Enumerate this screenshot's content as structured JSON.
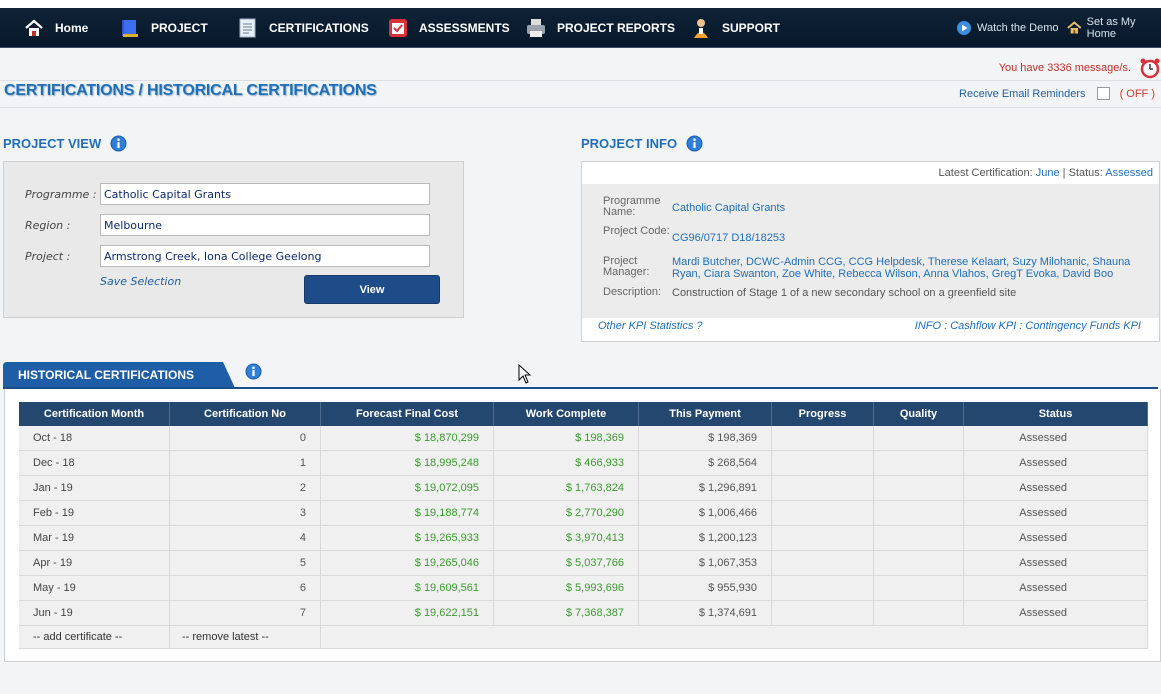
{
  "nav": {
    "items": [
      {
        "label": "Home",
        "icon": "home-icon"
      },
      {
        "label": "PROJECT",
        "icon": "project-book-icon"
      },
      {
        "label": "CERTIFICATIONS",
        "icon": "certificate-document-icon"
      },
      {
        "label": "ASSESSMENTS",
        "icon": "assessment-clipboard-icon"
      },
      {
        "label": "PROJECT REPORTS",
        "icon": "printer-icon"
      },
      {
        "label": "SUPPORT",
        "icon": "support-person-icon"
      }
    ],
    "watch_demo": "Watch the Demo",
    "set_home": "Set as My Home"
  },
  "messages": {
    "text": "You have 3336 message/s."
  },
  "page": {
    "title": "CERTIFICATIONS / HISTORICAL CERTIFICATIONS",
    "reminder_label": "Receive Email Reminders",
    "reminder_state": "( OFF )"
  },
  "project_view": {
    "title": "PROJECT VIEW",
    "programme_label": "Programme :",
    "programme_value": "Catholic Capital Grants",
    "region_label": "Region :",
    "region_value": "Melbourne",
    "project_label": "Project :",
    "project_value": "Armstrong Creek, Iona College Geelong",
    "save_selection": "Save Selection",
    "view_button": "View"
  },
  "project_info": {
    "title": "PROJECT INFO",
    "latest_label": "Latest Certification:",
    "latest_value": "June",
    "status_label": "Status:",
    "status_value": "Assessed",
    "programme_name_label": "Programme Name:",
    "programme_name": "Catholic Capital Grants",
    "project_code_label": "Project Code:",
    "project_code": "CG96/0717 D18/18253",
    "manager_label": "Project Manager:",
    "managers": "Mardi Butcher, DCWC-Admin CCG, CCG Helpdesk, Therese Kelaart, Suzy Milohanic, Shauna Ryan, Ciara Swanton, Zoe White, Rebecca Wilson, Anna Vlahos, GregT Evoka, David Boo",
    "description_label": "Description:",
    "description": "Construction of Stage 1 of a new secondary school on a greenfield site",
    "other_kpi": "Other KPI Statistics ?",
    "info_links": "INFO : Cashflow KPI : Contingency Funds KPI"
  },
  "historical": {
    "tab_label": "HISTORICAL CERTIFICATIONS",
    "columns": [
      "Certification Month",
      "Certification No",
      "Forecast Final Cost",
      "Work Complete",
      "This Payment",
      "Progress",
      "Quality",
      "Status"
    ],
    "rows": [
      [
        "Oct - 18",
        "0",
        "$ 18,870,299",
        "$ 198,369",
        "$ 198,369",
        "",
        "",
        "Assessed"
      ],
      [
        "Dec - 18",
        "1",
        "$ 18,995,248",
        "$ 466,933",
        "$ 268,564",
        "",
        "",
        "Assessed"
      ],
      [
        "Jan - 19",
        "2",
        "$ 19,072,095",
        "$ 1,763,824",
        "$ 1,296,891",
        "",
        "",
        "Assessed"
      ],
      [
        "Feb - 19",
        "3",
        "$ 19,188,774",
        "$ 2,770,290",
        "$ 1,006,466",
        "",
        "",
        "Assessed"
      ],
      [
        "Mar - 19",
        "4",
        "$ 19,265,933",
        "$ 3,970,413",
        "$ 1,200,123",
        "",
        "",
        "Assessed"
      ],
      [
        "Apr - 19",
        "5",
        "$ 19,265,046",
        "$ 5,037,766",
        "$ 1,067,353",
        "",
        "",
        "Assessed"
      ],
      [
        "May - 19",
        "6",
        "$ 19,609,561",
        "$ 5,993,696",
        "$ 955,930",
        "",
        "",
        "Assessed"
      ],
      [
        "Jun - 19",
        "7",
        "$ 19,622,151",
        "$ 7,368,387",
        "$ 1,374,691",
        "",
        "",
        "Assessed"
      ]
    ],
    "add_certificate": "-- add certificate --",
    "remove_latest": "-- remove latest --"
  },
  "colors": {
    "accent": "#1f6fb8",
    "nav_bg": "#0f2236",
    "positive": "#3a9b2d",
    "alert": "#d03a2a"
  }
}
